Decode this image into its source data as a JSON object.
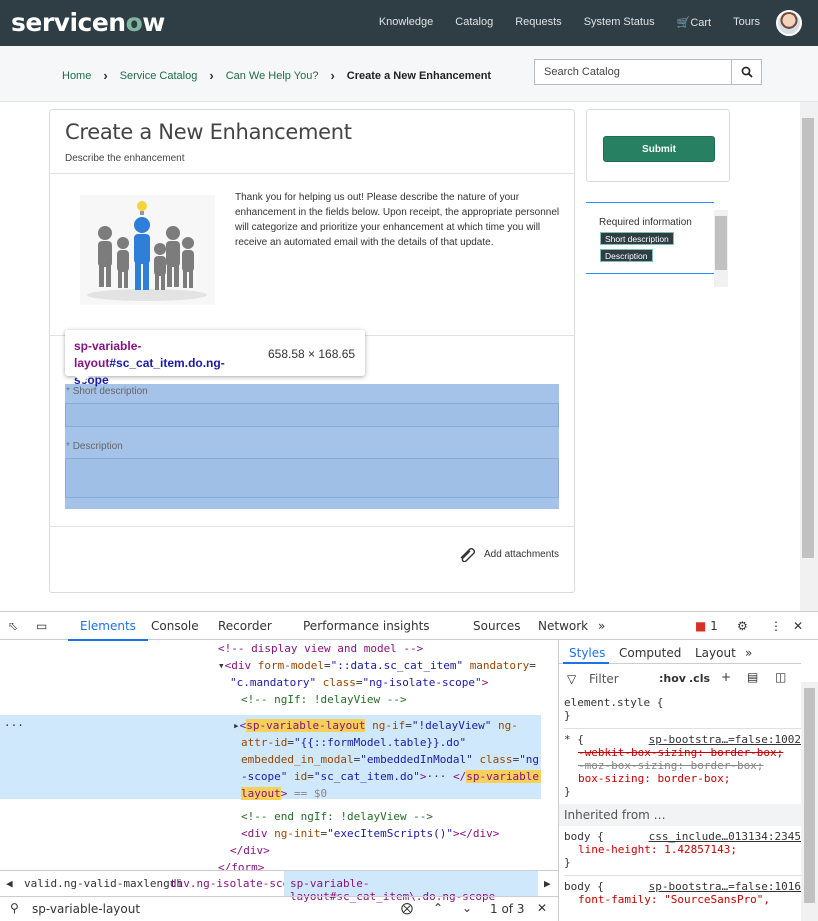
{
  "header": {
    "logo_text": "servicenow",
    "nav": [
      "Knowledge",
      "Catalog",
      "Requests",
      "System Status",
      "Cart",
      "Tours"
    ]
  },
  "breadcrumb": {
    "items": [
      "Home",
      "Service Catalog",
      "Can We Help You?",
      "Create a New Enhancement"
    ]
  },
  "search": {
    "placeholder": "Search Catalog"
  },
  "form": {
    "title": "Create a New Enhancement",
    "subtitle": "Describe the enhancement",
    "intro": "Thank you for helping us out! Please describe the nature of your enhancement in the fields below. Upon receipt, the appropriate personnel will categorize and prioritize your enhancement at which time you will receive an automated email with the details of that update.",
    "field1_label": "Short description",
    "field2_label": "Description",
    "required_mark": "*",
    "attach_label": "Add attachments"
  },
  "tooltip": {
    "selector_tag": "sp-variable-layout",
    "selector_rest": "#sc_cat_item.do.ng-scope",
    "size": "658.58 × 168.65"
  },
  "side": {
    "submit_label": "Submit",
    "required_title": "Required information",
    "required_tags": [
      "Short description",
      "Description"
    ]
  },
  "devtools": {
    "tabs": [
      "Elements",
      "Console",
      "Recorder",
      "Performance insights",
      "Sources",
      "Network"
    ],
    "error_count": "1",
    "styles_tabs": [
      "Styles",
      "Computed",
      "Layout"
    ],
    "filter_placeholder": "Filter",
    "hov": ":hov",
    "cls": ".cls",
    "element_style": "element.style {",
    "rule1_source": "sp-bootstra…=false:1002",
    "rule1_props": [
      "-webkit-box-sizing: border-box;",
      "-moz-box-sizing: border-box;",
      "box-sizing: border-box;"
    ],
    "inherited": "Inherited from …",
    "rule2_source": "css_include…013134:2345",
    "rule2_prop": "line-height: 1.42857143;",
    "rule3_source": "sp-bootstra…=false:1016",
    "rule3_prop": "font-family: \"SourceSansPro\",",
    "breadcrumbs": [
      "valid.ng-valid-maxlength",
      "div.ng-isolate-scope",
      "sp-variable-layout#sc_cat_item\\.do.ng-scope"
    ],
    "find_query": "sp-variable-layout",
    "find_count": "1 of 3",
    "dom_eq": "== $0"
  },
  "colors": {
    "header": "#2f3d45",
    "accent": "#278062",
    "link": "#1f6c45",
    "devtools_blue": "#1a73e8"
  }
}
